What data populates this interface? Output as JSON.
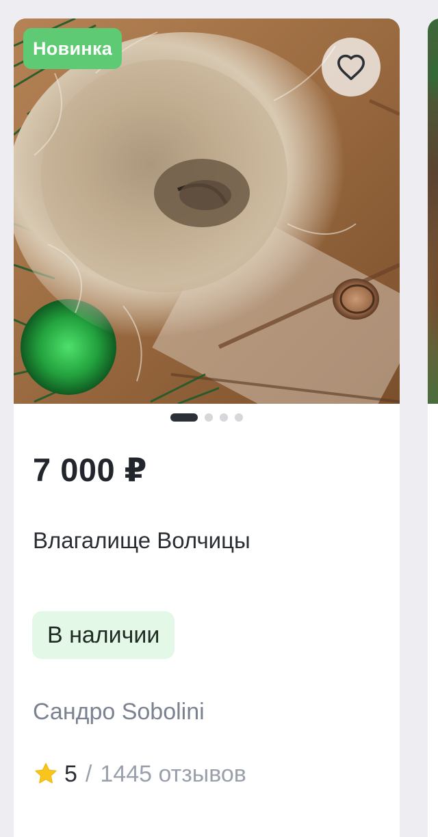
{
  "product": {
    "badge": "Новинка",
    "price": "7 000 ₽",
    "title": "Влагалище Волчицы",
    "stock": "В наличии",
    "seller": "Сандро Sobolini",
    "rating": {
      "score": "5",
      "separator": "/",
      "reviews": "1445 отзывов"
    },
    "gallery": {
      "count": 4,
      "active_index": 0
    }
  },
  "icons": {
    "favorite": "heart-outline-icon",
    "rating": "star-icon"
  },
  "colors": {
    "badge_new": "#5ecb74",
    "stock_bg": "#e3f8e7",
    "star": "#f7c51e",
    "text_primary": "#22262c",
    "text_muted": "#7a8190"
  }
}
